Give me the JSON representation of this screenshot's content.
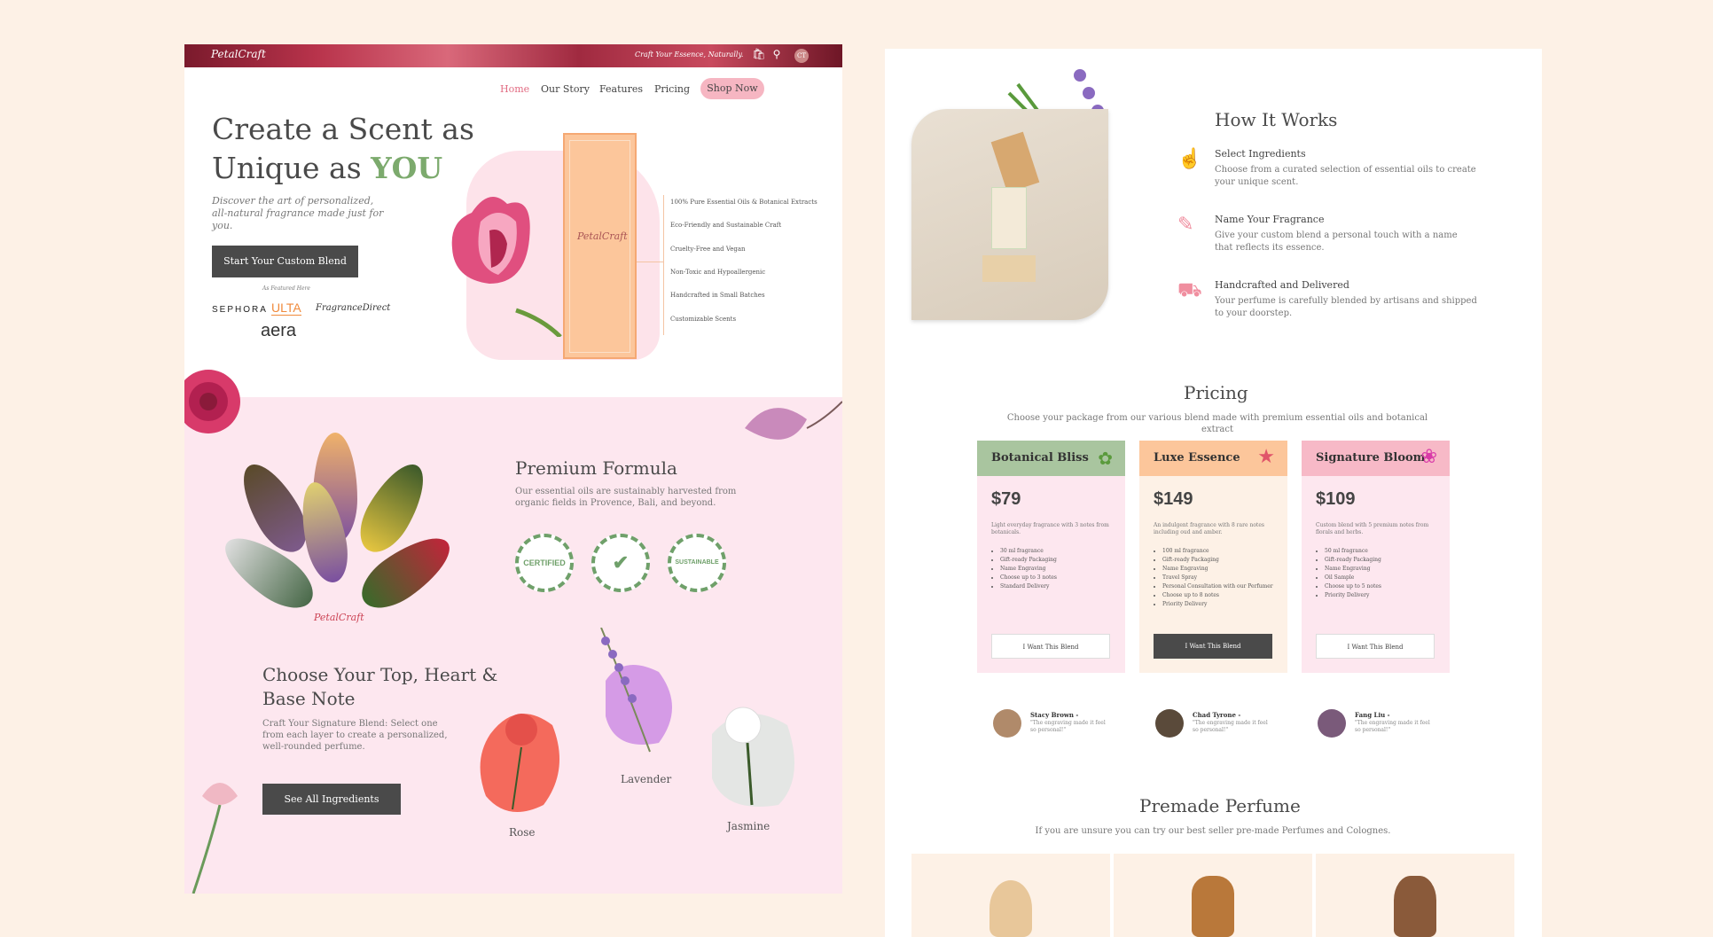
{
  "brand": {
    "logo": "PetalCraft",
    "tagline": "Craft Your Essence, Naturally.",
    "avatar_initials": "CT"
  },
  "nav": {
    "items": [
      "Home",
      "Our Story",
      "Features",
      "Pricing"
    ],
    "shop": "Shop Now"
  },
  "hero": {
    "title_line1": "Create a Scent as",
    "title_line2_prefix": "Unique as ",
    "title_highlight": "YOU",
    "subtitle": "Discover the art of personalized, all-natural fragrance made just for you.",
    "cta": "Start Your Custom Blend",
    "featured_label": "As Featured Here",
    "brands": [
      "SEPHORA",
      "ULTA",
      "FragranceDirect",
      "aera"
    ],
    "box_logo": "PetalCraft",
    "features": [
      "100% Pure Essential Oils & Botanical Extracts",
      "Eco-Friendly and Sustainable Craft",
      "Cruelty-Free and Vegan",
      "Non-Toxic and Hypoallergenic",
      "Handcrafted in Small Batches",
      "Customizable Scents"
    ]
  },
  "premium": {
    "title": "Premium Formula",
    "text": "Our essential oils are sustainably harvested from organic fields in Provence, Bali, and beyond.",
    "badges": [
      "CERTIFIED",
      "✔",
      "SUSTAINABLE"
    ],
    "logo": "PetalCraft"
  },
  "notes": {
    "title_line1": "Choose Your Top, Heart &",
    "title_line2": "Base Note",
    "text": "Craft Your Signature Blend: Select one from each layer to create a personalized, well-rounded perfume.",
    "cta": "See All Ingredients",
    "flowers": [
      "Rose",
      "Lavender",
      "Jasmine"
    ]
  },
  "how": {
    "title": "How It Works",
    "steps": [
      {
        "title": "Select Ingredients",
        "text": "Choose from a curated selection of essential oils to create your unique scent."
      },
      {
        "title": "Name Your Fragrance",
        "text": "Give your custom blend a personal touch with a name that reflects its essence."
      },
      {
        "title": "Handcrafted and Delivered",
        "text": "Your perfume is carefully blended by artisans and shipped to your doorstep."
      }
    ]
  },
  "pricing": {
    "title": "Pricing",
    "subtitle": "Choose your package from our various blend made with premium essential oils and botanical extract",
    "plans": [
      {
        "name": "Botanical Bliss",
        "price": "$79",
        "desc": "Light everyday fragrance with 3 notes from botanicals.",
        "features": [
          "30 ml fragrance",
          "Gift-ready Packaging",
          "Name Engraving",
          "Choose up to 3 notes",
          "Standard Delivery"
        ],
        "button": "I Want This Blend",
        "head_color": "#a9c59f",
        "body_color": "#fde7ef"
      },
      {
        "name": "Luxe Essence",
        "price": "$149",
        "desc": "An indulgent fragrance with 8 rare notes including oud and amber.",
        "features": [
          "100 ml fragrance",
          "Gift-ready Packaging",
          "Name Engraving",
          "Travel Spray",
          "Personal Consultation with our Perfumer",
          "Choose up to 8 notes",
          "Priority Delivery"
        ],
        "button": "I Want This Blend",
        "head_color": "#fcc69b",
        "body_color": "#fdf1e6"
      },
      {
        "name": "Signature Bloom",
        "price": "$109",
        "desc": "Custom blend with 5 premium notes from florals and herbs.",
        "features": [
          "50 ml fragrance",
          "Gift-ready Packaging",
          "Name Engraving",
          "Oil Sample",
          "Choose up to 5 notes",
          "Priority Delivery"
        ],
        "button": "I Want This Blend",
        "head_color": "#f7b9c7",
        "body_color": "#fde7ef"
      }
    ]
  },
  "testimonials": [
    {
      "name": "Stacy Brown -",
      "quote": "\"The engraving made it feel so personal!\""
    },
    {
      "name": "Chad Tyrone -",
      "quote": "\"The engraving made it feel so personal!\""
    },
    {
      "name": "Fang Liu -",
      "quote": "\"The engraving made it feel so personal!\""
    }
  ],
  "premade": {
    "title": "Premade Perfume",
    "subtitle": "If you are unsure you can try our best seller pre-made Perfumes and Colognes."
  }
}
